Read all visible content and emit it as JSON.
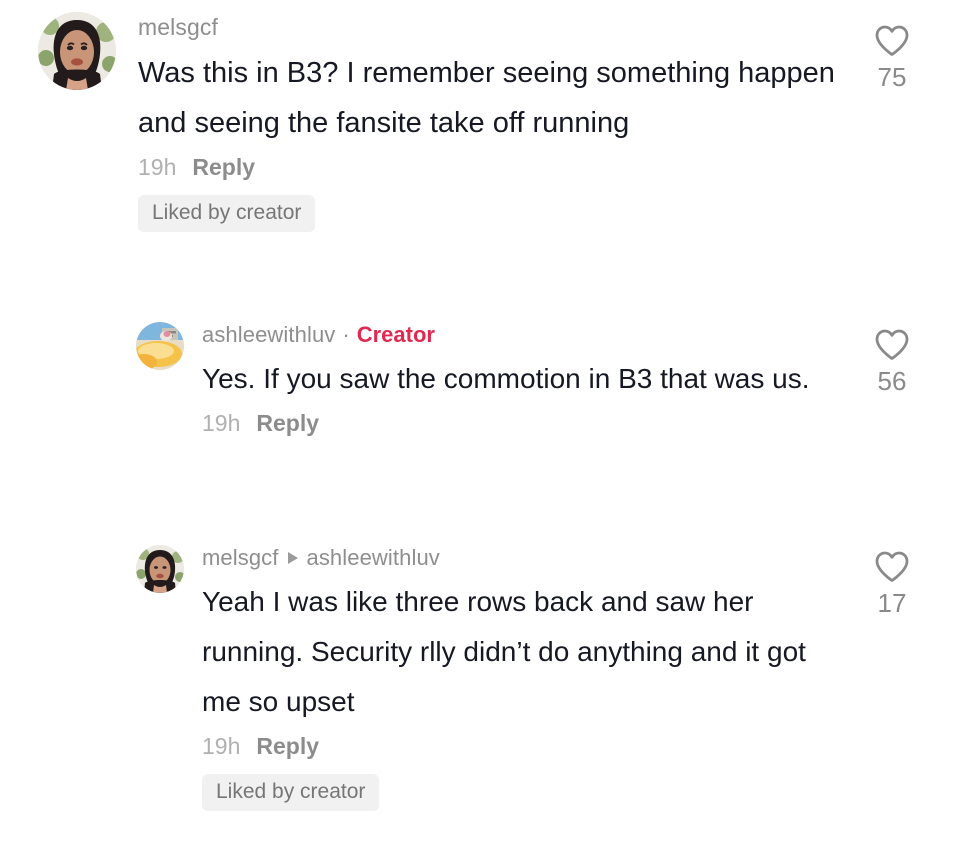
{
  "app": {
    "name": "tiktok-comments",
    "background": "#ffffff",
    "accent_creator": "#e02a50",
    "text_primary": "#161823",
    "text_muted": "#8e8e8e",
    "badge_bg": "#f1f1f2"
  },
  "comments": [
    {
      "id": "comment-1",
      "username": "melsgcf",
      "is_creator": false,
      "creator_label": "",
      "reply_to": "",
      "text": "Was this in B3? I remember seeing something happen and seeing the fansite take off running",
      "time": "19h",
      "reply_label": "Reply",
      "liked_by_creator": true,
      "liked_by_creator_label": "Liked by creator",
      "like_count": "75",
      "like_icon": "heart-outline-icon",
      "avatar_alt": "melsgcf-avatar"
    },
    {
      "id": "comment-2",
      "username": "ashleewithluv",
      "is_creator": true,
      "creator_label": "Creator",
      "reply_to": "",
      "text": "Yes. If you saw the commotion in B3 that was us.",
      "time": "19h",
      "reply_label": "Reply",
      "liked_by_creator": false,
      "liked_by_creator_label": "",
      "like_count": "56",
      "like_icon": "heart-outline-icon",
      "avatar_alt": "ashleewithluv-avatar"
    },
    {
      "id": "comment-3",
      "username": "melsgcf",
      "is_creator": false,
      "creator_label": "",
      "reply_to": "ashleewithluv",
      "reply_arrow": "triangle-right-icon",
      "text": "Yeah I was like three rows back and saw her running. Security rlly didn’t do anything and it got me so upset",
      "time": "19h",
      "reply_label": "Reply",
      "liked_by_creator": true,
      "liked_by_creator_label": "Liked by creator",
      "like_count": "17",
      "like_icon": "heart-outline-icon",
      "avatar_alt": "melsgcf-avatar"
    }
  ],
  "separator": {
    "dot": "·"
  }
}
